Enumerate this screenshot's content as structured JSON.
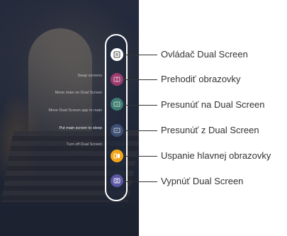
{
  "menu": {
    "items": [
      {
        "label": "Ovládač Dual Screen",
        "color": "#ffffff",
        "icon": "dual-screen-controller-icon"
      },
      {
        "label": "Prehodiť obrazovky",
        "color": "#9c3c6e",
        "icon": "swap-screens-icon"
      },
      {
        "label": "Presunúť na Dual Screen",
        "color": "#3f7d73",
        "icon": "move-to-dual-screen-icon"
      },
      {
        "label": "Presunúť z Dual Screen",
        "color": "#3d4f72",
        "icon": "move-from-dual-screen-icon"
      },
      {
        "label": "Uspanie hlavnej obrazovky",
        "color": "#f2a51a",
        "icon": "main-screen-sleep-icon"
      },
      {
        "label": "Vypnúť Dual Screen",
        "color": "#5b58a6",
        "icon": "turn-off-dual-screen-icon"
      }
    ]
  },
  "faint_menu": [
    "Swap screens",
    "Move main on Dual Screen",
    "Move Dual Screen app to main",
    "Put main screen to sleep",
    "Turn off Dual Screen"
  ]
}
